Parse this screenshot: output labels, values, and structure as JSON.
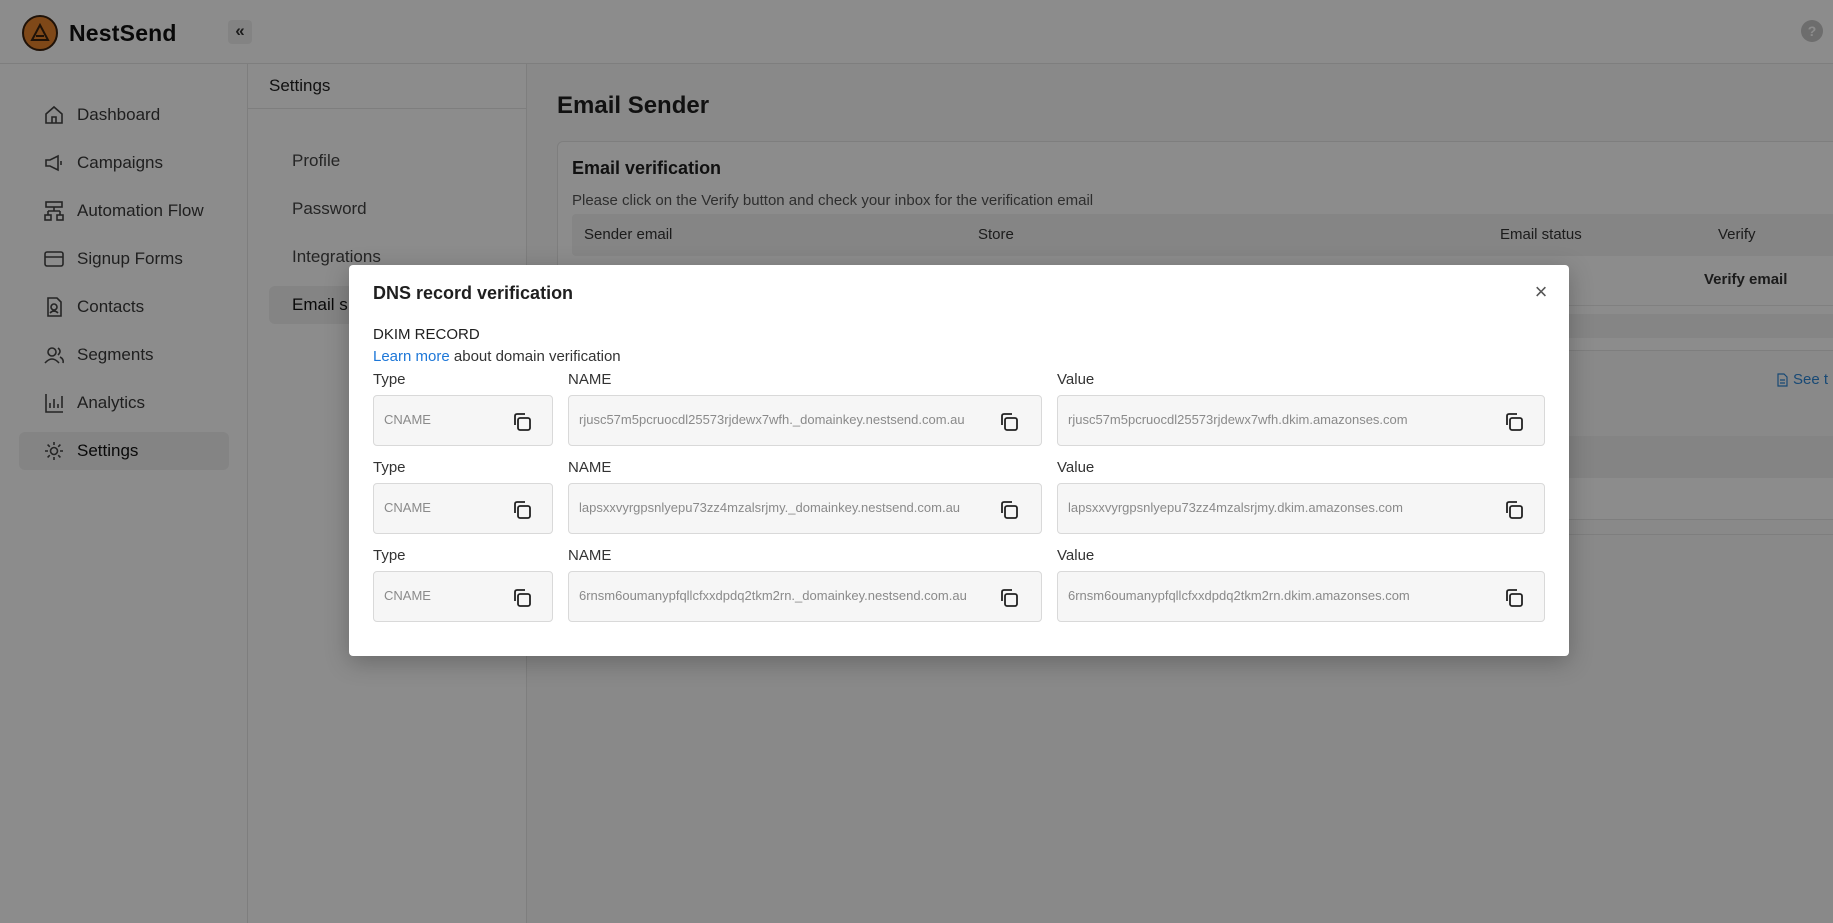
{
  "header": {
    "brand": "NestSend",
    "collapse_glyph": "«",
    "help_glyph": "?"
  },
  "sidebar": {
    "items": [
      {
        "label": "Dashboard",
        "icon": "home-icon"
      },
      {
        "label": "Campaigns",
        "icon": "megaphone-icon"
      },
      {
        "label": "Automation Flow",
        "icon": "flow-icon"
      },
      {
        "label": "Signup Forms",
        "icon": "form-icon"
      },
      {
        "label": "Contacts",
        "icon": "contacts-icon"
      },
      {
        "label": "Segments",
        "icon": "users-icon"
      },
      {
        "label": "Analytics",
        "icon": "chart-icon"
      },
      {
        "label": "Settings",
        "icon": "gear-icon",
        "active": true
      }
    ]
  },
  "settings": {
    "title": "Settings",
    "items": [
      "Profile",
      "Password",
      "Integrations",
      "Email s"
    ]
  },
  "main": {
    "title": "Email Sender",
    "card": {
      "title": "Email verification",
      "description": "Please click on the Verify button and check your inbox for the verification email",
      "columns": [
        "Sender email",
        "Store",
        "Email status",
        "Verify"
      ],
      "verify_link": "Verify email"
    },
    "see_tutorial": "See t"
  },
  "modal": {
    "title": "DNS record verification",
    "close_glyph": "×",
    "section_label": "DKIM RECORD",
    "learn_more": "Learn more",
    "learn_more_rest": " about domain verification",
    "records": [
      {
        "type_label": "Type",
        "type": "CNAME",
        "name_label": "NAME",
        "name": "rjusc57m5pcruocdl25573rjdewx7wfh._domainkey.nestsend.com.au",
        "value_label": "Value",
        "value": "rjusc57m5pcruocdl25573rjdewx7wfh.dkim.amazonses.com"
      },
      {
        "type_label": "Type",
        "type": "CNAME",
        "name_label": "NAME",
        "name": "lapsxxvyrgpsnlyepu73zz4mzalsrjmy._domainkey.nestsend.com.au",
        "value_label": "Value",
        "value": "lapsxxvyrgpsnlyepu73zz4mzalsrjmy.dkim.amazonses.com"
      },
      {
        "type_label": "Type",
        "type": "CNAME",
        "name_label": "NAME",
        "name": "6rnsm6oumanypfqllcfxxdpdq2tkm2rn._domainkey.nestsend.com.au",
        "value_label": "Value",
        "value": "6rnsm6oumanypfqllcfxxdpdq2tkm2rn.dkim.amazonses.com"
      }
    ]
  },
  "colors": {
    "accent_link": "#1d77d8",
    "brand_orange": "#e8842c",
    "overlay": "rgba(0,0,0,0.45)"
  }
}
